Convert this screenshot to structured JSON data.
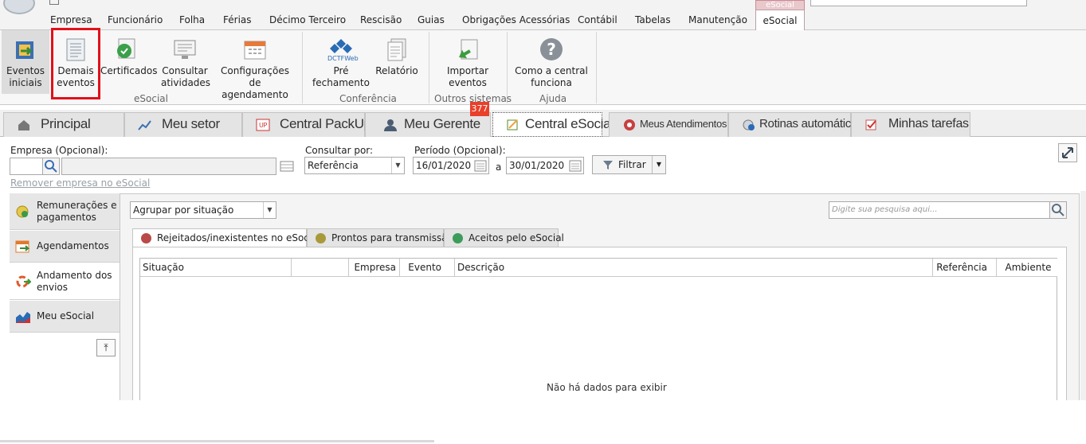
{
  "menu": {
    "items": [
      "Empresa",
      "Funcionário",
      "Folha",
      "Férias",
      "Décimo Terceiro",
      "Rescisão",
      "Guias",
      "Obrigações Acessórias",
      "Contábil",
      "Tabelas",
      "Manutenção"
    ],
    "context_label": "eSocial",
    "active_tab": "eSocial"
  },
  "ribbon": {
    "eventos_iniciais": "Eventos\niniciais",
    "demais_eventos": "Demais\neventos",
    "certificados": "Certificados",
    "consultar_atividades": "Consultar\natividades",
    "configuracoes": "Configurações\nde agendamento",
    "pre_fechamento": "Pré\nfechamento",
    "dctf_web": "DCTFWeb",
    "relatorio": "Relatório",
    "importar_eventos": "Importar\neventos",
    "como_funciona": "Como a central\nfunciona",
    "groups": [
      "eSocial",
      "Conferência",
      "Outros sistemas",
      "Ajuda"
    ]
  },
  "tabs": [
    "Principal",
    "Meu setor",
    "Central PackUp",
    "Meu Gerente",
    "Central eSocial",
    "Meus Atendimentos",
    "Rotinas automáticas",
    "Minhas tarefas"
  ],
  "badge_count": "377",
  "filters": {
    "empresa_label": "Empresa (Opcional):",
    "consultar_label": "Consultar por:",
    "consultar_value": "Referência",
    "periodo_label": "Período (Opcional):",
    "date_from": "16/01/2020",
    "date_sep": "a",
    "date_to": "30/01/2020",
    "filtrar": "Filtrar",
    "remover_link": "Remover empresa no eSocial"
  },
  "left_panel": [
    "Remunerações e\npagamentos",
    "Agendamentos",
    "Andamento dos\nenvios",
    "Meu eSocial"
  ],
  "content": {
    "agrupar_value": "Agrupar por situação",
    "search_placeholder": "Digite sua pesquisa aqui...",
    "subtabs": [
      {
        "label": "Rejeitados/inexistentes no eSocial",
        "color": "#b94a48"
      },
      {
        "label": "Prontos para transmissão",
        "color": "#a89a3a"
      },
      {
        "label": "Aceitos pelo eSocial",
        "color": "#3d9c5a"
      }
    ],
    "columns": [
      "Situação",
      "",
      "Empresa",
      "Evento",
      "Descrição",
      "Referência",
      "Ambiente"
    ],
    "empty_text": "Não há dados para exibir"
  }
}
